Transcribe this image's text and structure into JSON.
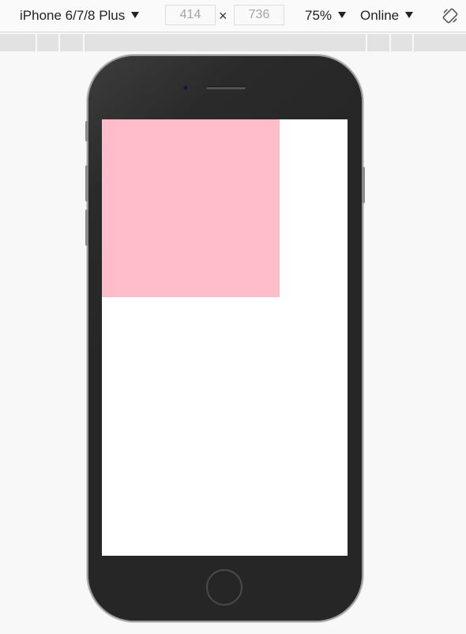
{
  "toolbar": {
    "device_label": "iPhone 6/7/8 Plus",
    "width_value": "414",
    "height_value": "736",
    "times_symbol": "×",
    "zoom_label": "75%",
    "network_label": "Online",
    "rotate_icon": "rotate-icon",
    "caret_icon": "caret-down-icon"
  },
  "colors": {
    "pink_box": "#ffbccb",
    "screen_bg": "#ffffff",
    "device_body": "#262626"
  }
}
